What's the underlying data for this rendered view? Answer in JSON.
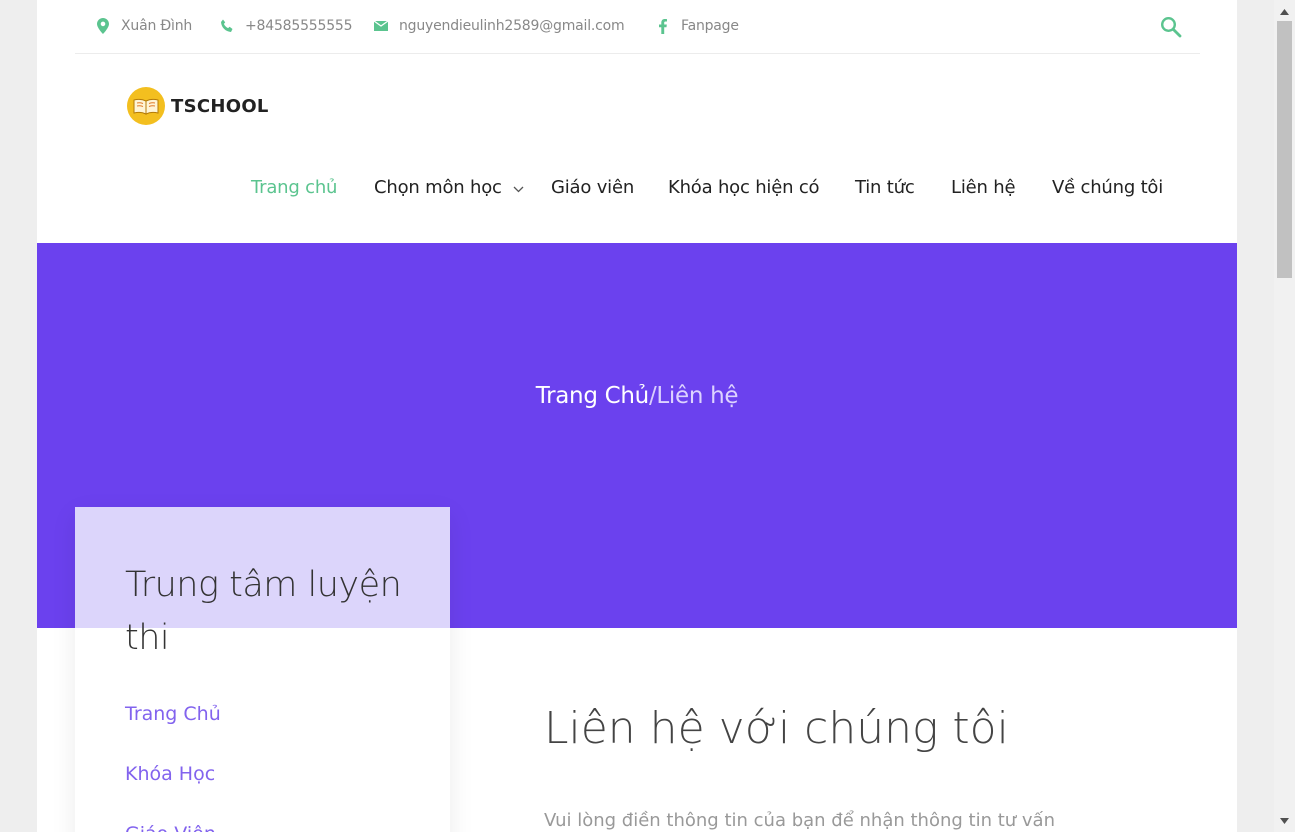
{
  "topbar": {
    "address": "Xuân Đình",
    "phone": "+84585555555",
    "email": "nguyendieulinh2589@gmail.com",
    "fanpage": "Fanpage"
  },
  "logo": {
    "text": "TSCHOOL"
  },
  "nav": [
    {
      "label": "Trang chủ"
    },
    {
      "label": "Chọn môn học"
    },
    {
      "label": "Giáo viên"
    },
    {
      "label": "Khóa học hiện có"
    },
    {
      "label": "Tin tức"
    },
    {
      "label": "Liên hệ"
    },
    {
      "label": "Về chúng tôi"
    }
  ],
  "breadcrumb": {
    "home": "Trang Chủ",
    "separator": "/",
    "current": "Liên hệ"
  },
  "sidebar": {
    "title": "Trung tâm luyện thi",
    "links": [
      "Trang Chủ",
      "Khóa Học",
      "Giáo Viên"
    ]
  },
  "main": {
    "title": "Liên hệ với chúng tôi",
    "description": "Vui lòng điền thông tin của bạn để nhận thông tin tư vấn"
  },
  "colors": {
    "accent_green": "#5bc48f",
    "hero_purple": "#6b41ee",
    "card_lavender": "#dcd5fb",
    "link_purple": "#8263ee"
  }
}
